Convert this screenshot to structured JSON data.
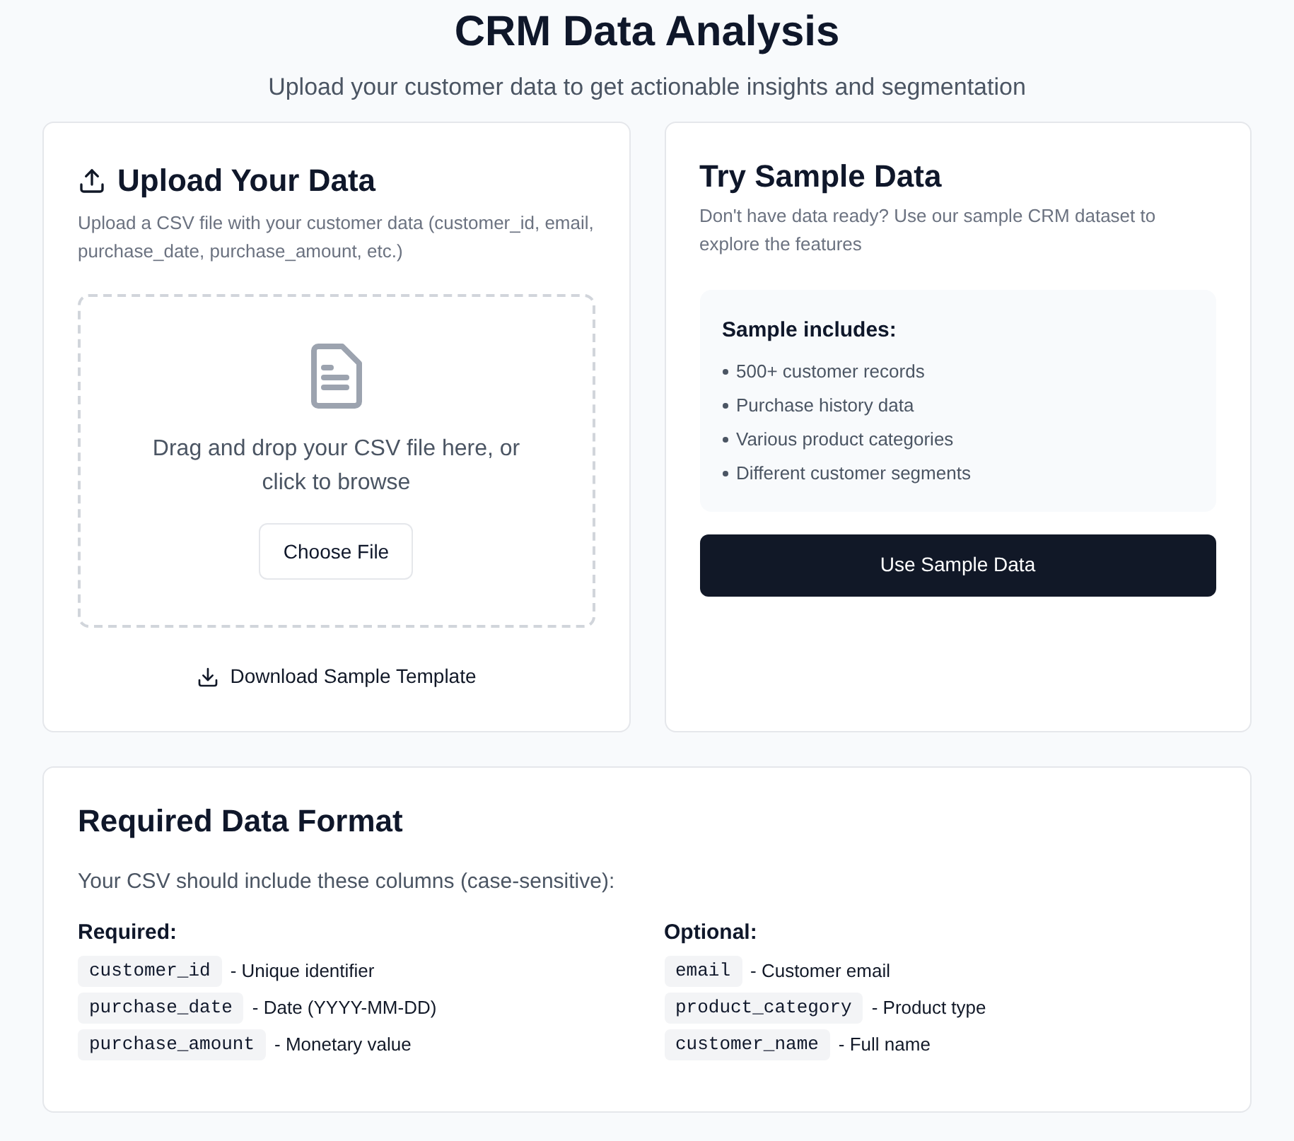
{
  "header": {
    "title": "CRM Data Analysis",
    "subtitle": "Upload your customer data to get actionable insights and segmentation"
  },
  "upload_card": {
    "title": "Upload Your Data",
    "description": "Upload a CSV file with your customer data (customer_id, email, purchase_date, purchase_amount, etc.)",
    "dropzone_text": "Drag and drop your CSV file here, or click to browse",
    "choose_button": "Choose File",
    "download_link": "Download Sample Template"
  },
  "sample_card": {
    "title": "Try Sample Data",
    "description": "Don't have data ready? Use our sample CRM dataset to explore the features",
    "includes_title": "Sample includes:",
    "includes": [
      "500+ customer records",
      "Purchase history data",
      "Various product categories",
      "Different customer segments"
    ],
    "button": "Use Sample Data"
  },
  "format_card": {
    "title": "Required Data Format",
    "intro": "Your CSV should include these columns (case-sensitive):",
    "groups": [
      {
        "title": "Required:",
        "columns": [
          {
            "name": "customer_id",
            "description": "- Unique identifier"
          },
          {
            "name": "purchase_date",
            "description": "- Date (YYYY-MM-DD)"
          },
          {
            "name": "purchase_amount",
            "description": "- Monetary value"
          }
        ]
      },
      {
        "title": "Optional:",
        "columns": [
          {
            "name": "email",
            "description": "- Customer email"
          },
          {
            "name": "product_category",
            "description": "- Product type"
          },
          {
            "name": "customer_name",
            "description": "- Full name"
          }
        ]
      }
    ]
  }
}
